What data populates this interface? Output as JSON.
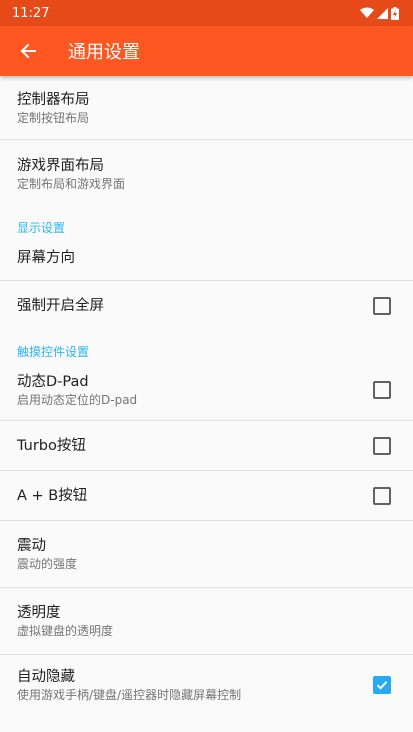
{
  "status_bar": {
    "time": "11:27"
  },
  "app_bar": {
    "title": "通用设置"
  },
  "items": {
    "controller_layout": {
      "title": "控制器布局",
      "summary": "定制按钮布局"
    },
    "game_ui_layout": {
      "title": "游戏界面布局",
      "summary": "定制布局和游戏界面"
    },
    "screen_orientation": {
      "title": "屏幕方向"
    },
    "force_fullscreen": {
      "title": "强制开启全屏",
      "checked": false
    },
    "dynamic_dpad": {
      "title": "动态D-Pad",
      "summary": "启用动态定位的D-pad",
      "checked": false
    },
    "turbo": {
      "title": "Turbo按钮",
      "checked": false
    },
    "ab_button": {
      "title": "A + B按钮",
      "checked": false
    },
    "vibration": {
      "title": "震动",
      "summary": "震动的强度"
    },
    "opacity": {
      "title": "透明度",
      "summary": "虚拟键盘的透明度"
    },
    "auto_hide": {
      "title": "自动隐藏",
      "summary": "使用游戏手柄/键盘/遥控器时隐藏屏幕控制",
      "checked": true
    }
  },
  "categories": {
    "display": "显示设置",
    "touch": "触摸控件设置"
  },
  "colors": {
    "status_bar": "#e64a19",
    "app_bar": "#ff5722",
    "accent": "#29b6f6"
  }
}
